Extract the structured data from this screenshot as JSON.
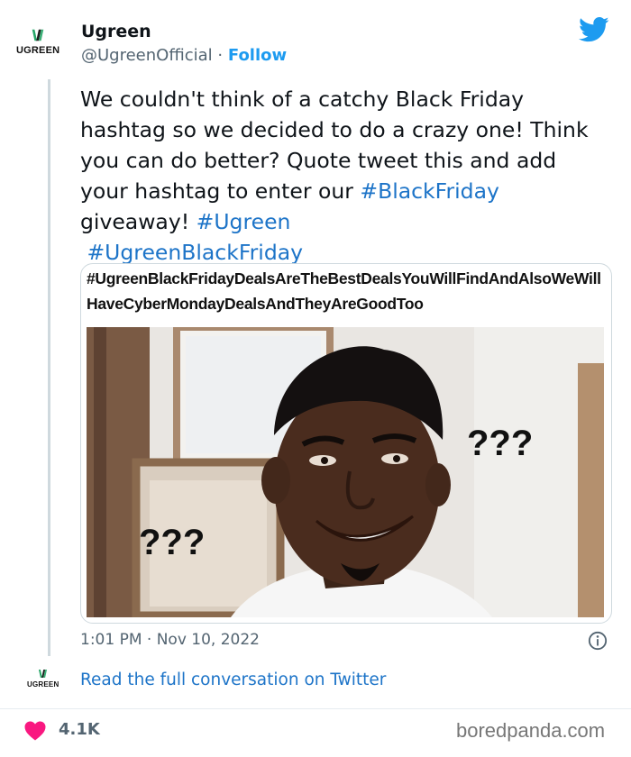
{
  "author": {
    "name": "Ugreen",
    "handle": "@UgreenOfficial",
    "separator": "·",
    "follow_label": "Follow",
    "logo_text": "UGREEN",
    "avatar_icon": "ugreen-logo-icon"
  },
  "platform_icon": "twitter-bird-icon",
  "tweet": {
    "text": "We couldn't think of a catchy Black Friday hashtag so we decided to do a crazy one! Think you can do better? Quote tweet this and add your hashtag to enter our",
    "hashtag_1": "#BlackFriday",
    "text_mid": "giveaway!",
    "hashtag_2": "#Ugreen",
    "hashtag_3": "#UgreenBlackFriday"
  },
  "media": {
    "caption": "#UgreenBlackFridayDealsAreTheBestDealsYouWillFindAndAlsoWeWillHaveCyberMondayDealsAndTheyAreGoodToo",
    "question_marks_left": "???",
    "question_marks_right": "???"
  },
  "meta": {
    "timestamp": "1:01 PM · Nov 10, 2022",
    "info_icon": "info-icon"
  },
  "conversation": {
    "logo_text": "UGREEN",
    "link_label": "Read the full conversation on Twitter"
  },
  "footer": {
    "like_count": "4.1K",
    "heart_icon": "heart-icon",
    "watermark": "boredpanda.com"
  },
  "colors": {
    "link_blue": "#1d74c8",
    "twitter_blue": "#1d9bf0",
    "ugreen_green": "#27a668",
    "heart_pink": "#f91880"
  }
}
